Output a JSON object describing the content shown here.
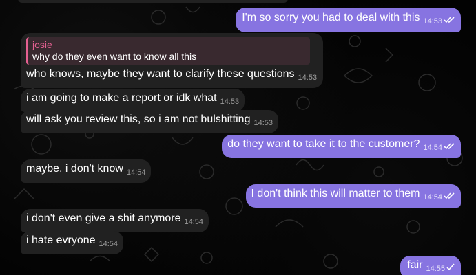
{
  "messages": [
    {
      "text": "I'm so sorry you had to deal with this",
      "time": "14:53"
    },
    {
      "reply_name": "josie",
      "reply_text": "why do they even want to know all this",
      "text": "who knows, maybe they want to clarify these questions",
      "time": "14:53"
    },
    {
      "text": "i am going to make a report or idk what",
      "time": "14:53"
    },
    {
      "text": "will ask you review this, so i am not bulshitting",
      "time": "14:53"
    },
    {
      "text": "do they want to take it to the customer?",
      "time": "14:54"
    },
    {
      "text": "maybe, i don't know",
      "time": "14:54"
    },
    {
      "text": "I don't think this will matter to them",
      "time": "14:54"
    },
    {
      "text": "i don't even give a shit anymore",
      "time": "14:54"
    },
    {
      "text": "i hate evryone",
      "time": "14:54"
    },
    {
      "text": "fair",
      "time": "14:55"
    }
  ],
  "colors": {
    "outgoing_bubble": "#8774e1",
    "incoming_bubble": "#212121",
    "reply_accent": "#e56091",
    "background": "#000000"
  },
  "icons": {
    "read_receipt": "double-check-icon",
    "sent_receipt": "single-check-icon"
  }
}
